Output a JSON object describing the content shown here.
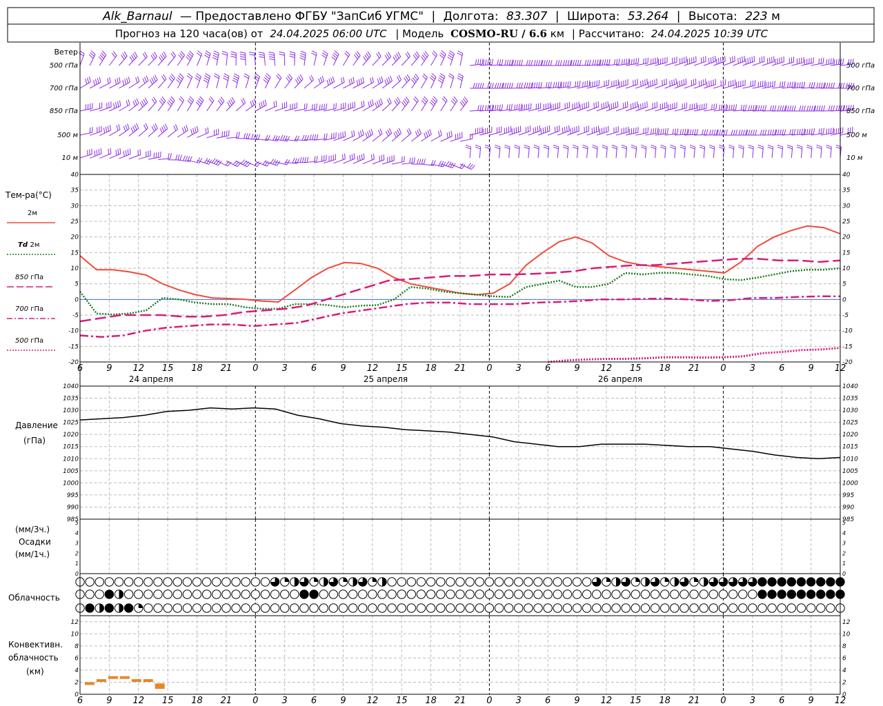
{
  "header": {
    "row1": {
      "station": "Alk_Barnaul",
      "provided_label": "— Предоставлено ФГБУ \"ЗапСиб УГМС\"",
      "lon_label": "Долгота:",
      "lon_value": "83.307",
      "lat_label": "Широта:",
      "lat_value": "53.264",
      "alt_label": "Высота:",
      "alt_value": "223",
      "alt_unit": "м"
    },
    "row2": {
      "forecast_label": "Прогноз на 120 часа(ов) от",
      "forecast_time": "24.04.2025 06:00 UTC",
      "model_label": "| Модель",
      "model_name": "COSMO-RU / 6.6",
      "model_unit": "км",
      "calc_label": "| Рассчитано:",
      "calc_time": "24.04.2025 10:39 UTC"
    }
  },
  "wind_panel": {
    "title": "Ветер",
    "levels": [
      "500 гПа",
      "700 гПа",
      "850 гПа",
      "500 м",
      "10  м"
    ],
    "color": "#8a2be2"
  },
  "temp_panel": {
    "title": "Тем-ра(°С)",
    "legend": [
      {
        "label": "2м",
        "italic_prefix": "",
        "color": "#f04a3a",
        "style": "solid"
      },
      {
        "label": "2м",
        "italic_prefix": "Td",
        "color": "#1a7a1a",
        "style": "dotted"
      },
      {
        "label": "гПа",
        "italic_prefix": "850",
        "color": "#d81b7a",
        "style": "longdash"
      },
      {
        "label": "гПа",
        "italic_prefix": "700",
        "color": "#d81b7a",
        "style": "dashdot"
      },
      {
        "label": "гПа",
        "italic_prefix": "500",
        "color": "#d81b7a",
        "style": "dotted"
      }
    ],
    "y_ticks": [
      "40",
      "35",
      "30",
      "25",
      "20",
      "15",
      "10",
      "5",
      "0",
      "-5",
      "-10",
      "-15",
      "-20"
    ]
  },
  "pressure_panel": {
    "title": "Давление",
    "unit": "(гПа)",
    "y_ticks": [
      "1040",
      "1035",
      "1030",
      "1025",
      "1020",
      "1015",
      "1010",
      "1005",
      "1000",
      "995",
      "990",
      "985"
    ]
  },
  "precip_panel": {
    "unit_top": "(мм/3ч.)",
    "title": "Осадки",
    "unit_bottom": "(мм/1ч.)",
    "y_ticks": [
      "5",
      "4",
      "3",
      "2",
      "1",
      "0"
    ]
  },
  "cloud_panel": {
    "title": "Облачность"
  },
  "conv_panel": {
    "title_1": "Конвективн.",
    "title_2": "облачность",
    "unit": "(км)",
    "y_ticks": [
      "12",
      "10",
      "8",
      "6",
      "4",
      "2",
      "0"
    ]
  },
  "time_axis": {
    "hour_labels": [
      "6",
      "9",
      "12",
      "15",
      "18",
      "21",
      "0",
      "3",
      "6",
      "9",
      "12",
      "15",
      "18",
      "21",
      "0",
      "3",
      "6",
      "9",
      "12",
      "15",
      "18",
      "21",
      "0",
      "3",
      "6",
      "9",
      "12"
    ],
    "day_labels": [
      "24 апреля",
      "25 апреля",
      "26 апреля"
    ]
  },
  "chart_data": {
    "type": "line",
    "x_hours": [
      0,
      3,
      6,
      9,
      12,
      15,
      18,
      21,
      24,
      27,
      30,
      33,
      36,
      39,
      42,
      45,
      48,
      51,
      54,
      57,
      60,
      63,
      66,
      69,
      72,
      75,
      78
    ],
    "series": [
      {
        "name": "2м",
        "unit": "°C",
        "values": [
          14,
          9.5,
          9.5,
          8.8,
          7.8,
          5,
          3,
          1.5,
          0.5,
          0.3,
          0,
          -0.5,
          -0.8,
          3,
          7,
          10,
          11.8,
          11.5,
          10,
          7,
          5,
          4,
          3,
          2,
          1.5,
          2,
          5,
          11,
          15,
          18.5,
          20,
          18,
          14,
          12,
          11,
          10.5,
          10,
          9.5,
          9,
          8.5,
          12,
          17,
          20,
          22,
          23.5,
          23,
          21
        ]
      },
      {
        "name": "Td 2м",
        "unit": "°C",
        "values": [
          2.5,
          -4.5,
          -4.8,
          -4.5,
          -3.5,
          0.5,
          0,
          -1,
          -1.5,
          -1.5,
          -2.5,
          -3,
          -3,
          -1.5,
          -1.5,
          -1.8,
          -2.5,
          -2,
          -1.8,
          0,
          4,
          3.5,
          2.5,
          2,
          1.5,
          1,
          0.8,
          4,
          5,
          6,
          4,
          4,
          5,
          8.5,
          8,
          8.5,
          8.5,
          8,
          7.5,
          6.5,
          6.2,
          7,
          8,
          9,
          9.5,
          9.5,
          10
        ]
      },
      {
        "name": "850 гПа",
        "unit": "°C",
        "values": [
          -7,
          -6,
          -5,
          -5,
          -5,
          -5.5,
          -5.5,
          -5,
          -4,
          -3.5,
          -3,
          -2,
          0,
          2,
          4,
          6,
          6.5,
          7,
          7.5,
          7.5,
          8,
          8,
          8.2,
          8.5,
          9,
          10,
          10.5,
          11,
          11,
          11.5,
          12,
          12.5,
          13,
          13,
          12.5,
          12.5,
          12,
          12.5
        ]
      },
      {
        "name": "700 гПа",
        "unit": "°C",
        "values": [
          -11.5,
          -12,
          -11.5,
          -10,
          -9,
          -8.5,
          -8,
          -8,
          -8.5,
          -8,
          -7.5,
          -6,
          -4.5,
          -3.5,
          -2.5,
          -1.5,
          -1,
          -1,
          -1.5,
          -1.5,
          -1.5,
          -1,
          -0.8,
          -0.5,
          0,
          0,
          0.2,
          0.3,
          0,
          -0.5,
          -0.2,
          0.5,
          0.5,
          0.8,
          1,
          1
        ]
      },
      {
        "name": "500 гПа",
        "unit": "°C",
        "values": [
          -20,
          -19.5,
          -19.2,
          -19,
          -19,
          -18.8,
          -18.5,
          -18.5,
          -18.6,
          -18.5,
          -18.2,
          -17.2,
          -16.8,
          -16.2,
          -16,
          -15.5
        ]
      },
      {
        "name": "Давление",
        "unit": "гПа",
        "values": [
          1026,
          1026.5,
          1027,
          1028,
          1029.5,
          1030,
          1031,
          1030.5,
          1031,
          1030.5,
          1028,
          1026.5,
          1024.5,
          1023.5,
          1023,
          1022,
          1021.5,
          1021,
          1020,
          1019,
          1017,
          1016,
          1015,
          1015,
          1016,
          1016,
          1016,
          1015.5,
          1015,
          1015,
          1014,
          1013,
          1011.5,
          1010.5,
          1010,
          1010.5
        ]
      }
    ],
    "conv_clouds": {
      "unit": "км",
      "values": [
        2,
        2.5,
        3,
        3,
        2.5,
        2.5,
        1.8
      ]
    },
    "ylims": {
      "temperature": [
        -20,
        40
      ],
      "pressure": [
        985,
        1040
      ],
      "precip": [
        0,
        5
      ],
      "conv": [
        0,
        13
      ]
    },
    "grid": true
  }
}
